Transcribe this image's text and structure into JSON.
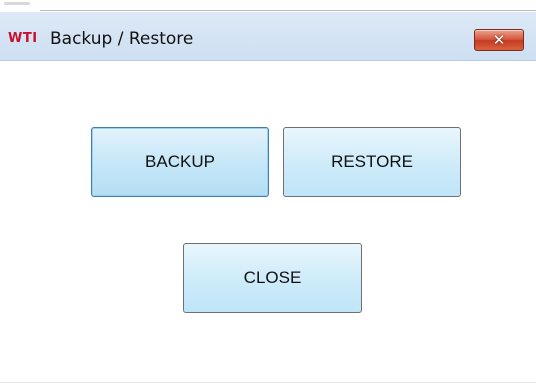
{
  "window": {
    "logo_text": "WTI",
    "title": "Backup / Restore",
    "close_glyph": "✕",
    "close_icon": "close-icon"
  },
  "buttons": {
    "backup_label": "BACKUP",
    "restore_label": "RESTORE",
    "close_label": "CLOSE"
  },
  "colors": {
    "titlebar": "#cddff2",
    "logo": "#c8102e",
    "close_button": "#d5543b",
    "button_fill": "#cdebfa",
    "focused_border": "#3c7fb1"
  }
}
